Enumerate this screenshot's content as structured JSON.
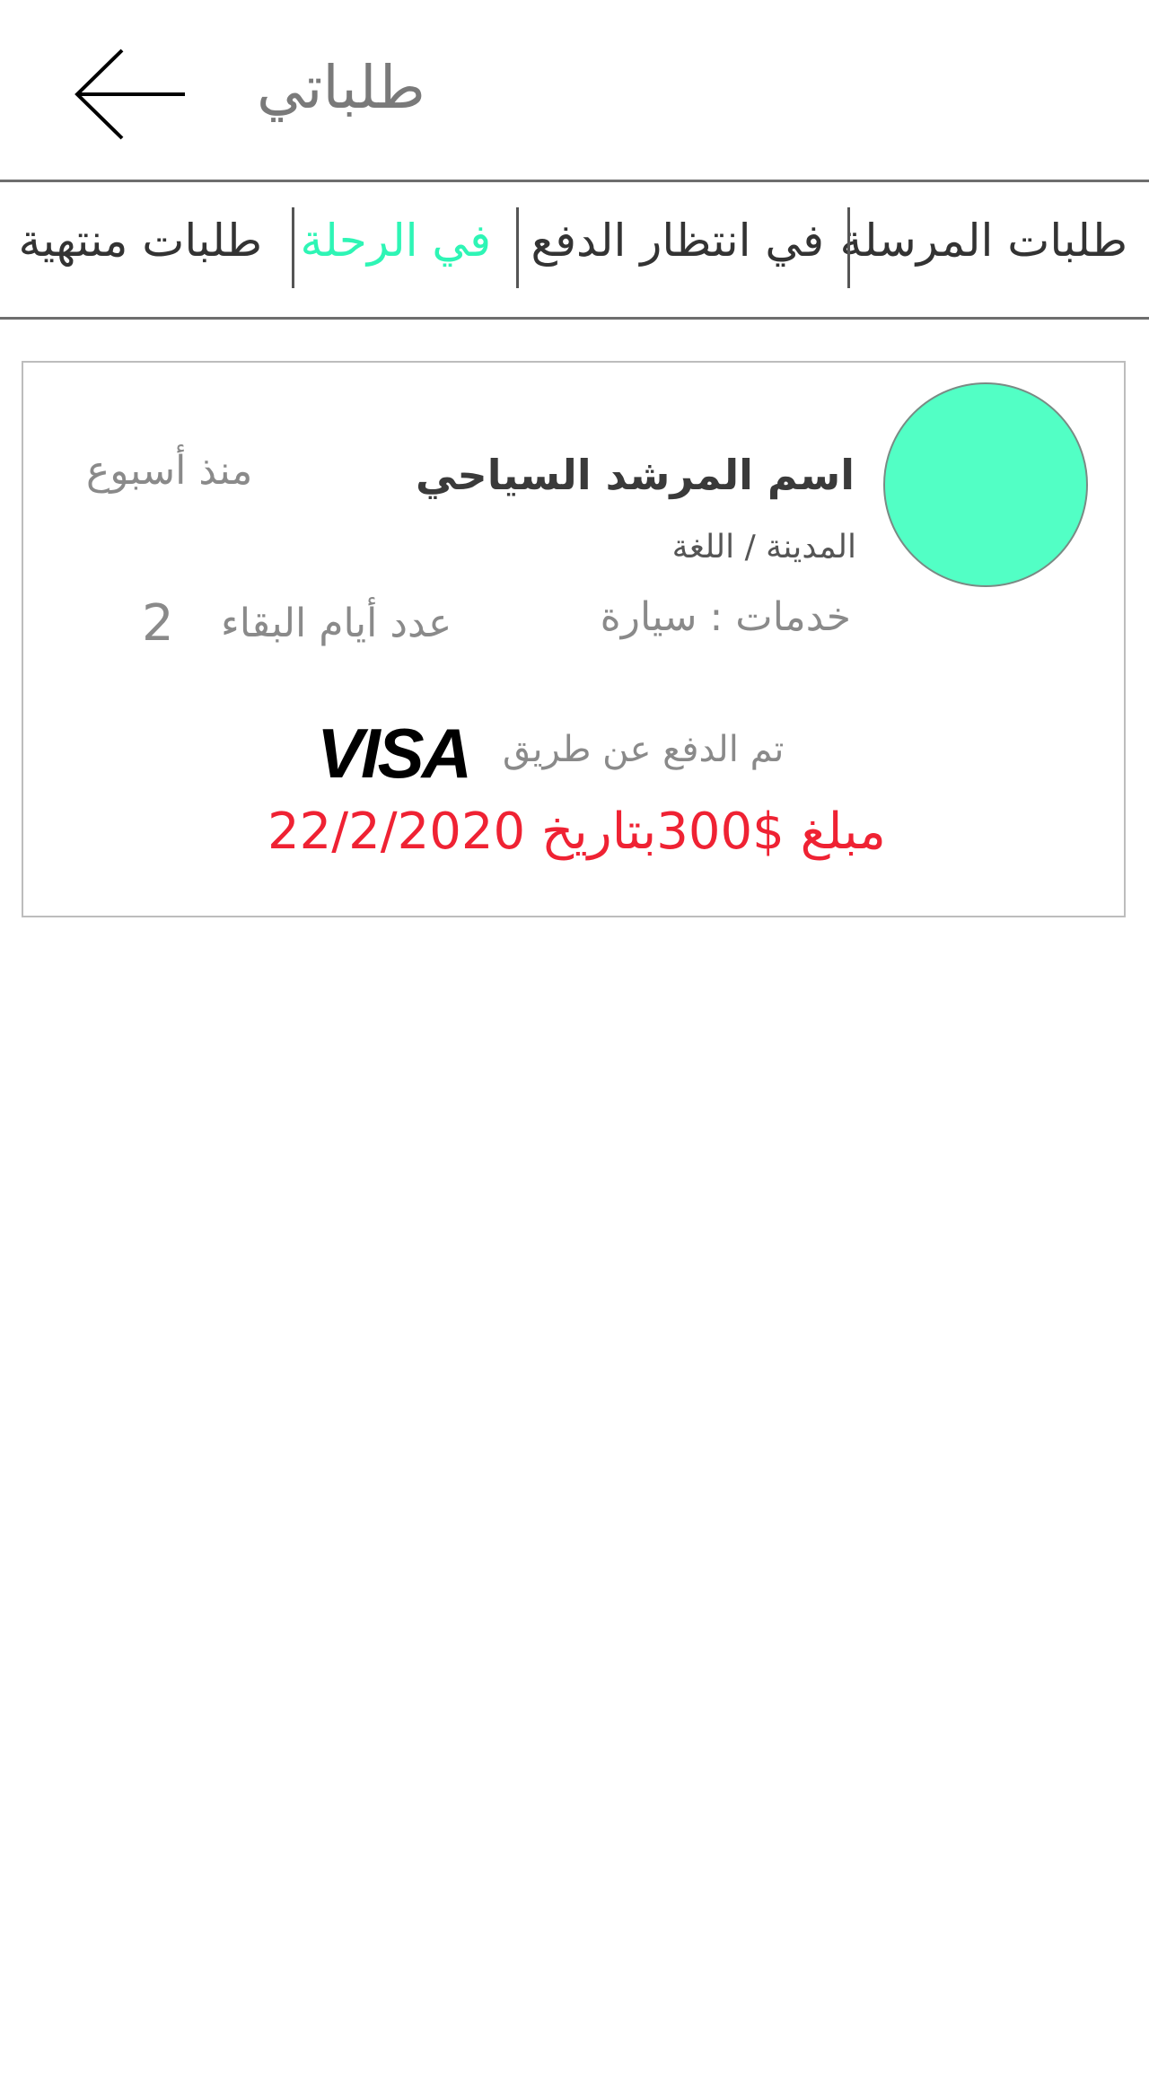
{
  "header": {
    "title": "طلباتي",
    "back_icon": "arrow-left-icon"
  },
  "tabs": [
    {
      "label": "طلبات المرسلة",
      "active": false
    },
    {
      "label": "في انتظار الدفع",
      "active": false
    },
    {
      "label": "في الرحلة",
      "active": true
    },
    {
      "label": "طلبات منتهية",
      "active": false
    }
  ],
  "colors": {
    "accent": "#2ef5b5",
    "avatar": "#52ffc5",
    "amount": "#ef2233"
  },
  "order": {
    "guide_name": "اسم المرشد السياحي",
    "since": "منذ أسبوع",
    "city_language": "المدينة / اللغة",
    "services": "خدمات : سيارة",
    "stay_days_label": "عدد أيام البقاء",
    "stay_days_value": "2",
    "paid_via": "تم الدفع عن طريق",
    "payment_brand": "VISA",
    "amount_line": "مبلغ $300بتاريخ 22/2/2020"
  }
}
